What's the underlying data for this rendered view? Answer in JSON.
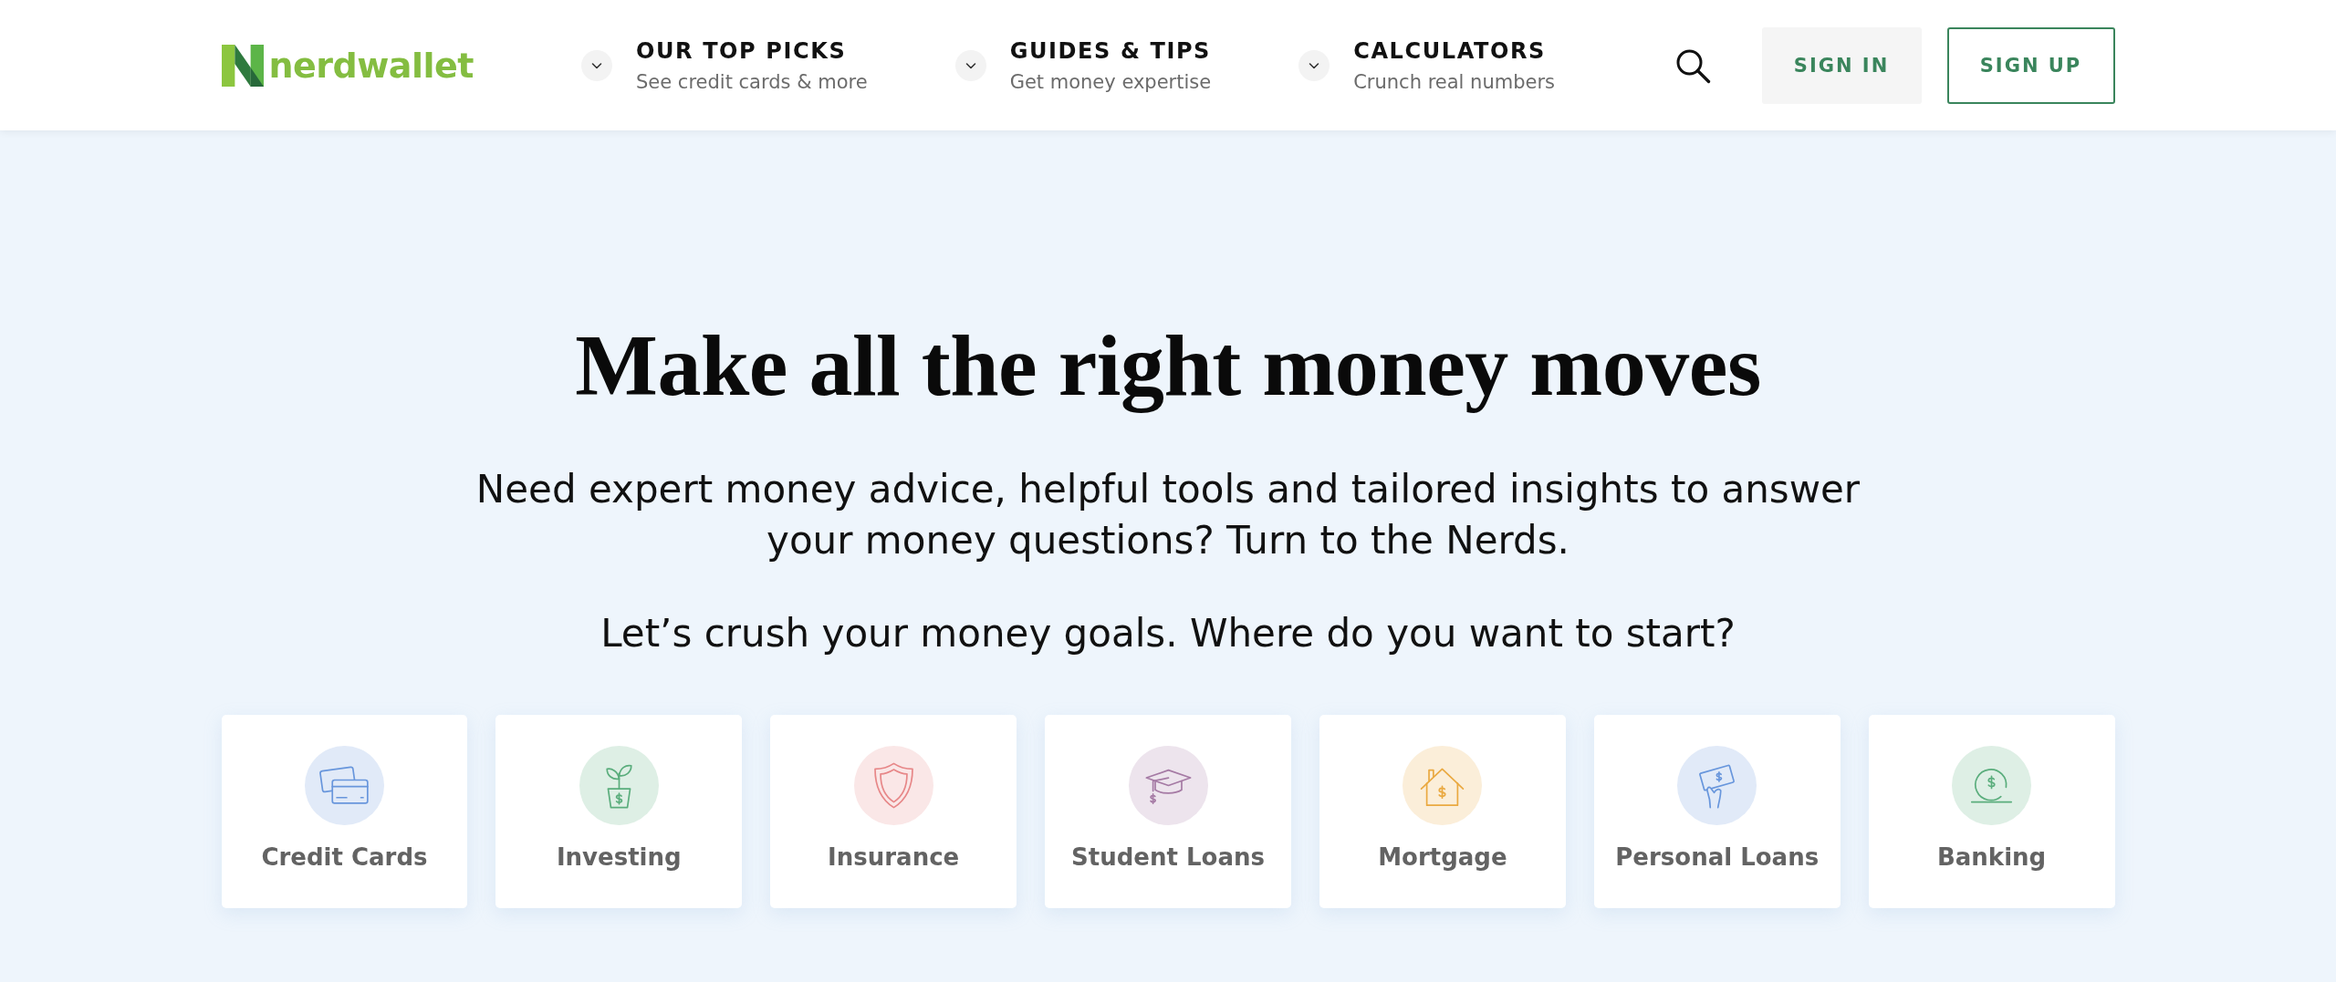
{
  "header": {
    "logo": {
      "text": "nerdwallet"
    },
    "nav": [
      {
        "title": "OUR TOP PICKS",
        "subtitle": "See credit cards & more"
      },
      {
        "title": "GUIDES & TIPS",
        "subtitle": "Get money expertise"
      },
      {
        "title": "CALCULATORS",
        "subtitle": "Crunch real numbers"
      }
    ],
    "actions": [
      {
        "label": "SIGN IN",
        "kind": "filled"
      },
      {
        "label": "SIGN UP",
        "kind": "outlined"
      }
    ]
  },
  "hero": {
    "title": "Make all the right money moves",
    "intro": "Need expert money advice, helpful tools and tailored insights to answer your money questions? Turn to the Nerds.",
    "prompt": "Let’s crush your money goals. Where do you want to start?"
  },
  "categories": [
    {
      "label": "Credit Cards",
      "kind": "card",
      "color": "#6896dc"
    },
    {
      "label": "Investing",
      "kind": "plant",
      "color": "#5aad7c"
    },
    {
      "label": "Insurance",
      "kind": "shield",
      "color": "#e78788"
    },
    {
      "label": "Student Loans",
      "kind": "cap",
      "color": "#a57aa4"
    },
    {
      "label": "Mortgage",
      "kind": "house",
      "color": "#eaa941"
    },
    {
      "label": "Personal Loans",
      "kind": "hand",
      "color": "#6896dc"
    },
    {
      "label": "Banking",
      "kind": "coin",
      "color": "#5aad7c"
    }
  ]
}
